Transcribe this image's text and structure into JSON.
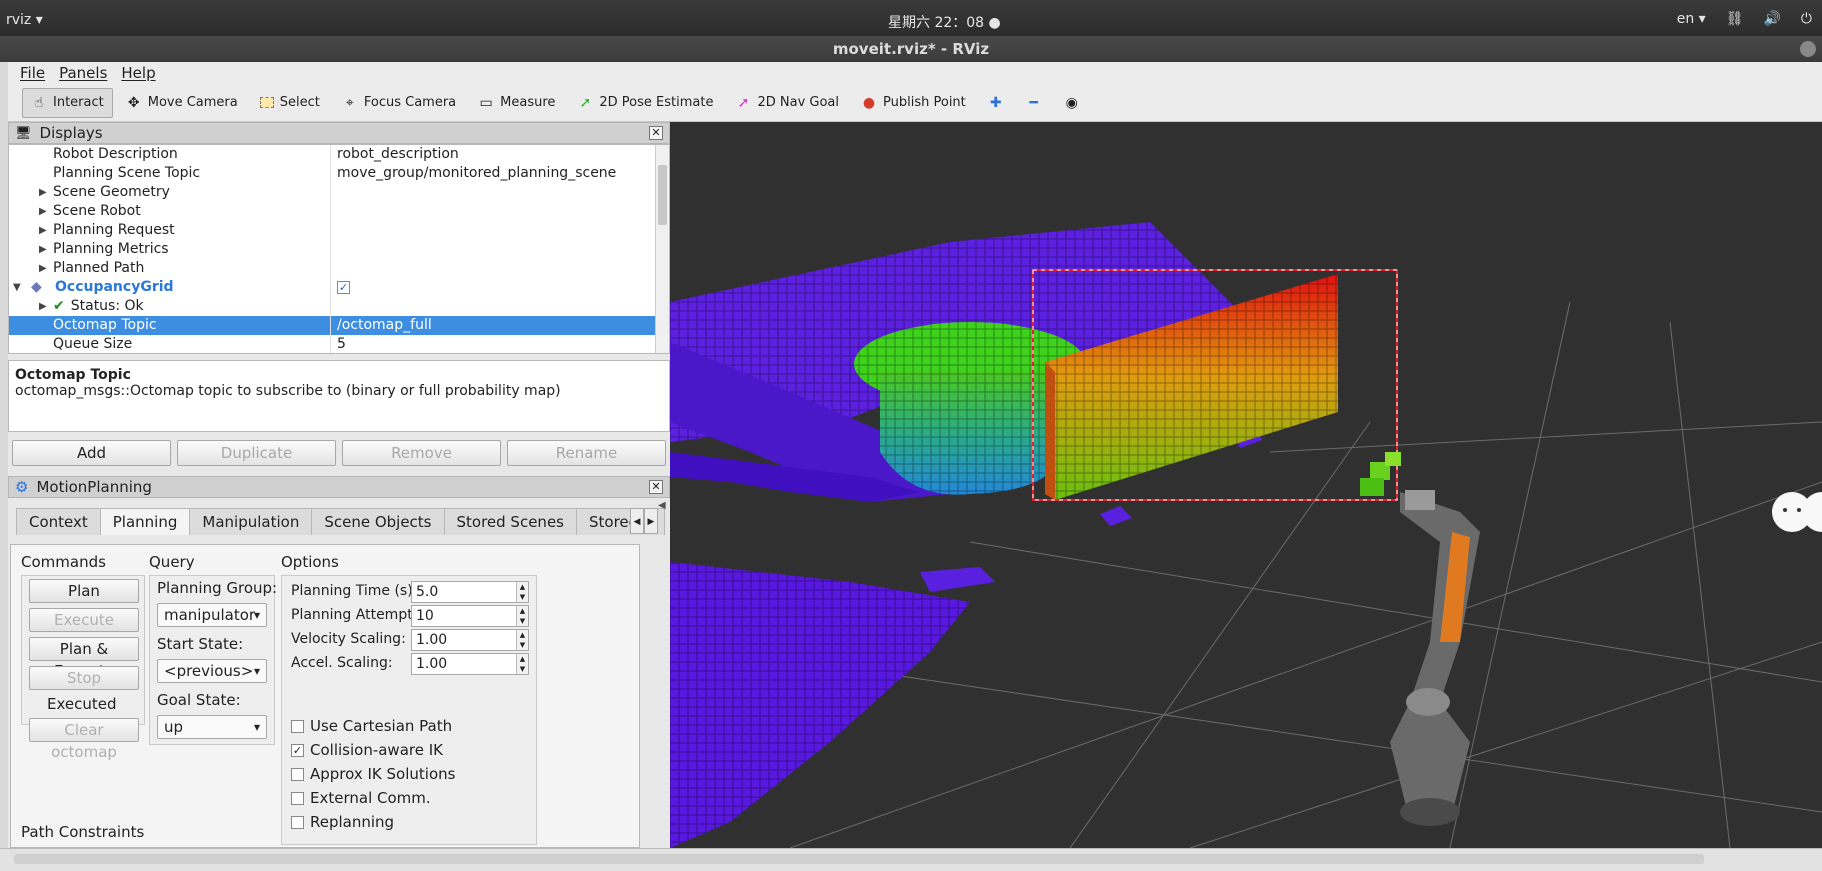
{
  "system": {
    "app_menu": "rviz ▾",
    "clock": "星期六 22：08 ●",
    "lang": "en ▾",
    "tray_icons": [
      "network-icon",
      "volume-icon",
      "power-icon"
    ]
  },
  "window": {
    "title": "moveit.rviz* - RViz"
  },
  "menu": {
    "file": "File",
    "panels": "Panels",
    "help": "Help"
  },
  "toolbar": {
    "tools": [
      {
        "label": "Interact",
        "icon": "pointer-icon",
        "active": true
      },
      {
        "label": "Move Camera",
        "icon": "move-camera-icon"
      },
      {
        "label": "Select",
        "icon": "select-icon"
      },
      {
        "label": "Focus Camera",
        "icon": "focus-camera-icon"
      },
      {
        "label": "Measure",
        "icon": "ruler-icon"
      },
      {
        "label": "2D Pose Estimate",
        "icon": "green-arrow-icon"
      },
      {
        "label": "2D Nav Goal",
        "icon": "pink-arrow-icon"
      },
      {
        "label": "Publish Point",
        "icon": "map-pin-icon"
      }
    ]
  },
  "displays": {
    "title": "Displays",
    "rows": [
      {
        "k": "Robot Description",
        "v": "robot_description"
      },
      {
        "k": "Planning Scene Topic",
        "v": "move_group/monitored_planning_scene"
      },
      {
        "k": "Scene Geometry",
        "v": ""
      },
      {
        "k": "Scene Robot",
        "v": ""
      },
      {
        "k": "Planning Request",
        "v": ""
      },
      {
        "k": "Planning Metrics",
        "v": ""
      },
      {
        "k": "Planned Path",
        "v": ""
      },
      {
        "k": "OccupancyGrid",
        "v": "✓"
      },
      {
        "k": "Status: Ok",
        "v": ""
      },
      {
        "k": "Octomap Topic",
        "v": "/octomap_full"
      },
      {
        "k": "Queue Size",
        "v": "5"
      }
    ],
    "desc_title": "Octomap Topic",
    "desc_text": "octomap_msgs::Octomap topic to subscribe to (binary or full probability map)",
    "buttons": {
      "add": "Add",
      "duplicate": "Duplicate",
      "remove": "Remove",
      "rename": "Rename"
    }
  },
  "motion": {
    "title": "MotionPlanning",
    "tabs": [
      "Context",
      "Planning",
      "Manipulation",
      "Scene Objects",
      "Stored Scenes",
      "Stored S"
    ],
    "commands": {
      "heading": "Commands",
      "plan": "Plan",
      "execute": "Execute",
      "plan_execute": "Plan & Execute",
      "stop": "Stop",
      "status": "Executed",
      "clear": "Clear octomap"
    },
    "query": {
      "heading": "Query",
      "group_label": "Planning Group:",
      "group": "manipulator",
      "start_label": "Start State:",
      "start": "<previous>",
      "goal_label": "Goal State:",
      "goal": "up"
    },
    "options": {
      "heading": "Options",
      "time_label": "Planning Time (s):",
      "time": "5.0",
      "attempts_label": "Planning Attempts:",
      "attempts": "10",
      "vel_label": "Velocity Scaling:",
      "vel": "1.00",
      "acc_label": "Accel. Scaling:",
      "acc": "1.00",
      "cartesian": "Use Cartesian Path",
      "collision": "Collision-aware IK",
      "approx": "Approx IK Solutions",
      "external": "External Comm.",
      "replanning": "Replanning"
    },
    "path_constraints": "Path Constraints"
  }
}
